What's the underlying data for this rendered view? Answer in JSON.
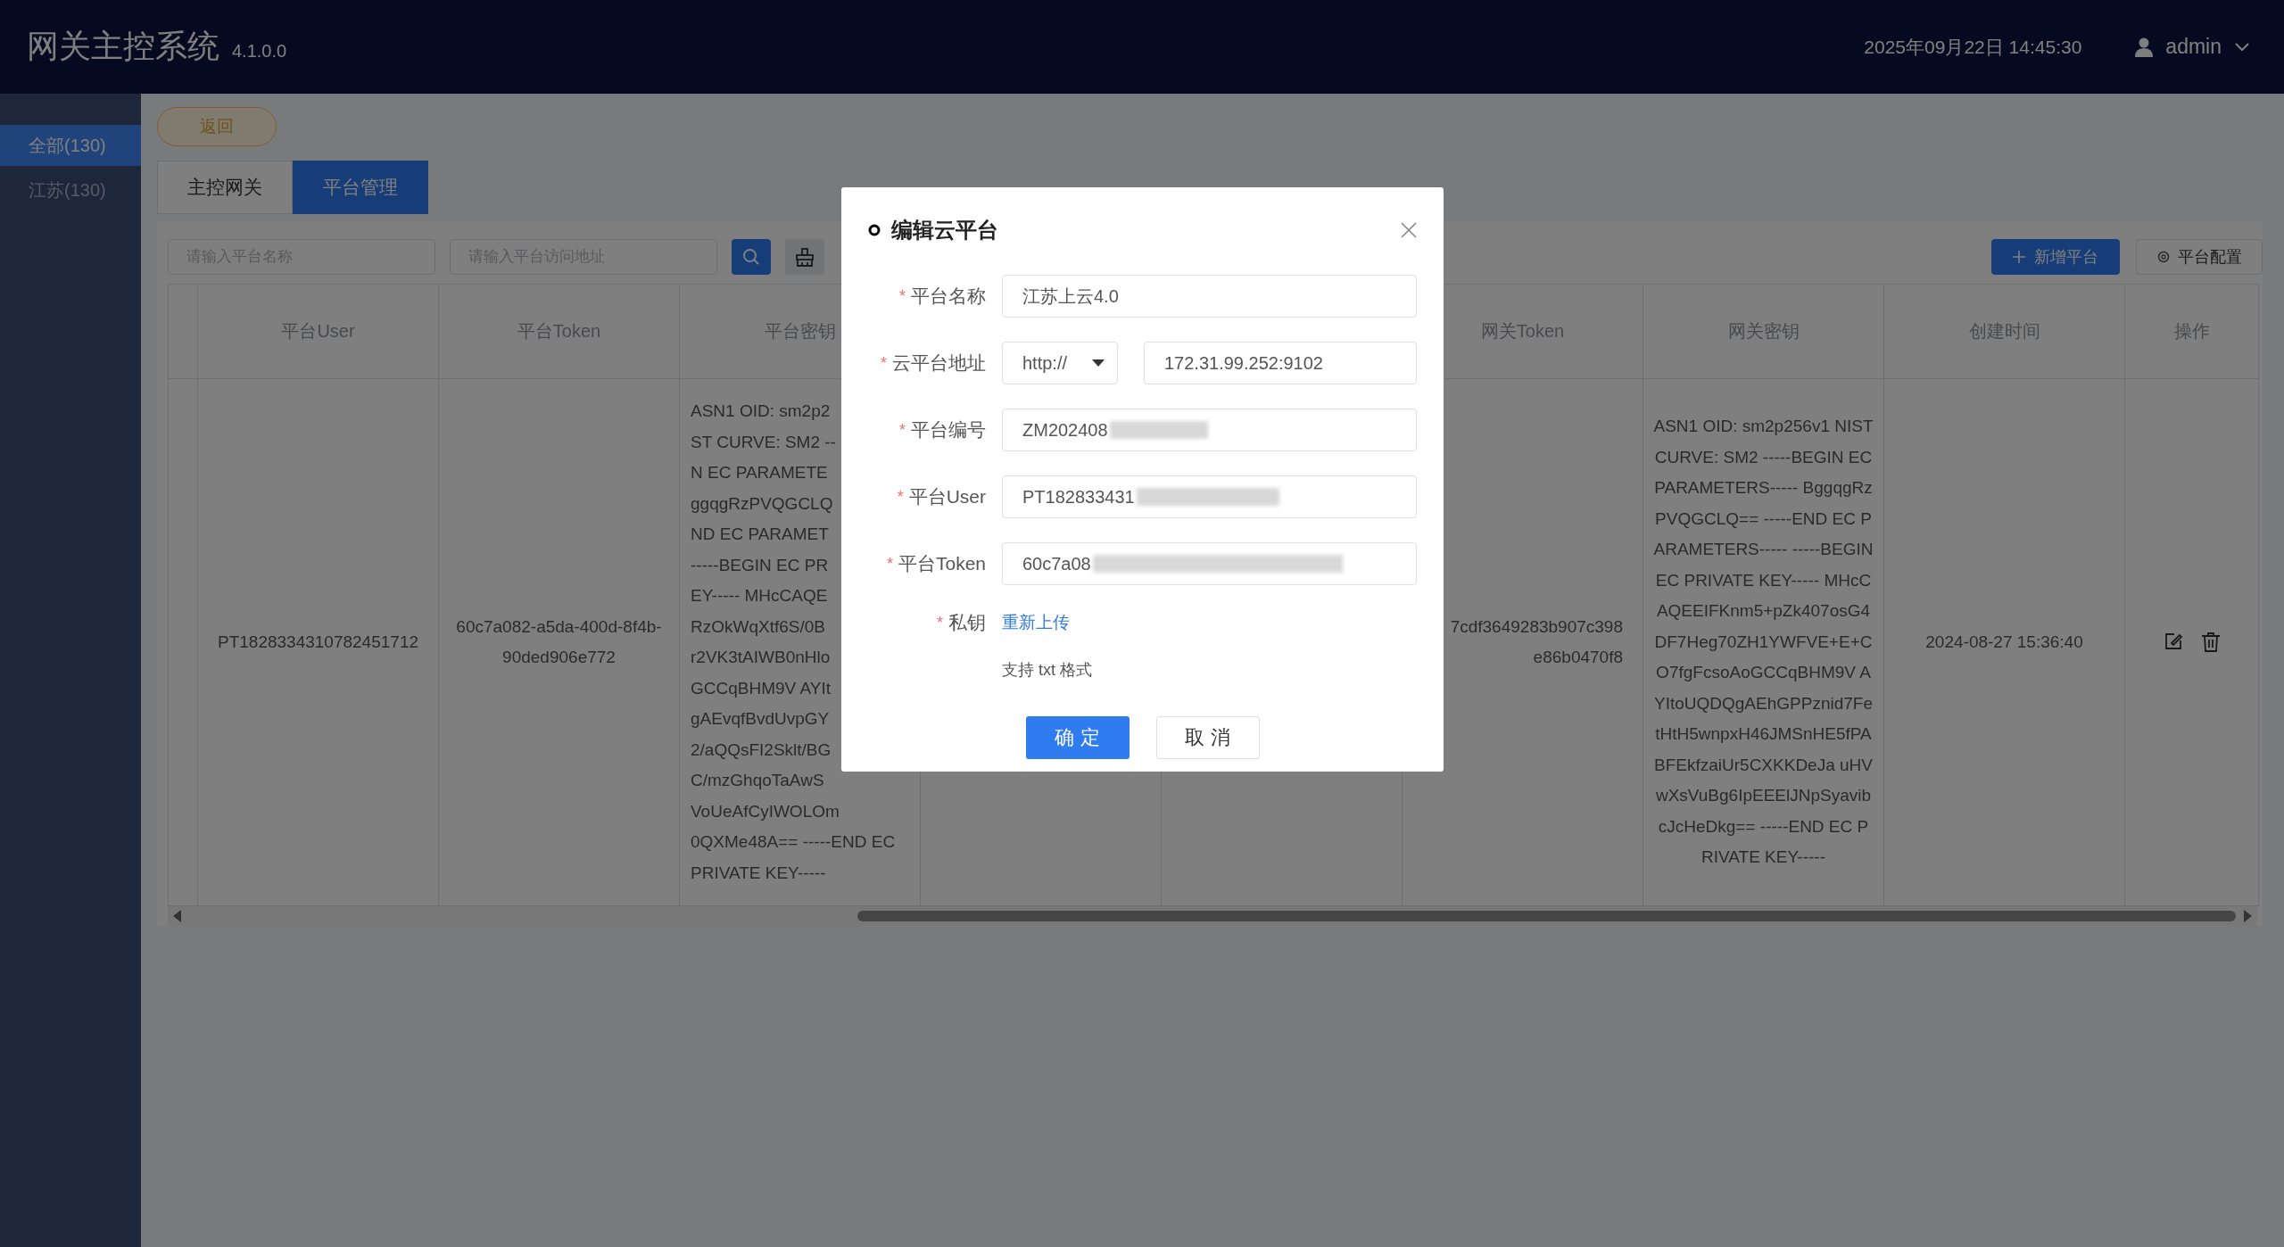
{
  "header": {
    "title": "网关主控系统",
    "version": "4.1.0.0",
    "datetime": "2025年09月22日 14:45:30",
    "user": "admin"
  },
  "sidebar": {
    "items": [
      {
        "label": "全部(130)",
        "selected": true
      },
      {
        "label": "江苏(130)",
        "selected": false
      }
    ]
  },
  "back_button": "返回",
  "tabs": [
    {
      "label": "主控网关",
      "selected": false
    },
    {
      "label": "平台管理",
      "selected": true
    }
  ],
  "toolbar": {
    "search_fields": [
      {
        "placeholder": "请输入平台名称"
      },
      {
        "placeholder": "请输入平台访问地址"
      }
    ],
    "add_button": "新增平台",
    "config_button": "平台配置"
  },
  "table": {
    "columns": [
      {
        "kind": "blank"
      },
      {
        "kind": "label",
        "label": "平台User"
      },
      {
        "kind": "label",
        "label": "平台Token"
      },
      {
        "kind": "label",
        "label": "平台密钥"
      },
      {
        "kind": "blank"
      },
      {
        "kind": "blank"
      },
      {
        "kind": "label",
        "label": "网关Token"
      },
      {
        "kind": "label",
        "label": "网关密钥"
      },
      {
        "kind": "label",
        "label": "创建时间"
      },
      {
        "kind": "label",
        "label": "操作"
      }
    ],
    "rows": [
      {
        "cells": [
          {
            "kind": "blank"
          },
          {
            "kind": "text",
            "text": "PT1828334310782451712"
          },
          {
            "kind": "text",
            "text": "60c7a082-a5da-400d-8f4b-90ded906e772"
          },
          {
            "kind": "cut_right",
            "lines": [
              "ASN1 OID: sm2p2",
              "ST CURVE: SM2 --",
              "N EC PARAMETE",
              "ggqgRzPVQGCLQ",
              "ND EC PARAMET",
              "-----BEGIN EC PR",
              "EY----- MHcCAQE",
              "RzOkWqXtf6S/0B",
              "r2VK3tAIWB0nHlo",
              "GCCqBHM9V AYIt",
              "gAEvqfBvdUvpGY",
              "2/aQQsFI2Sklt/BG",
              "C/mzGhqoTaAwS",
              "VoUeAfCyIWOLOm",
              "0QXMe48A== -----END EC",
              "PRIVATE KEY-----"
            ]
          },
          {
            "kind": "blank"
          },
          {
            "kind": "blank"
          },
          {
            "kind": "cut_left",
            "lines": [
              "7cdf3649283b907c398",
              "e86b0470f8"
            ]
          },
          {
            "kind": "text",
            "text": "ASN1 OID: sm2p256v1 NIST CURVE: SM2 -----BEGIN EC PARAMETERS----- BggqgRzPVQGCLQ== -----END EC PARAMETERS----- -----BEGIN EC PRIVATE KEY----- MHcCAQEEIFKnm5+pZk407osG4DF7Heg70ZH1YWFVE+E+CO7fgFcsoAoGCCqBHM9V AYItoUQDQgAEhGPPznid7FetHtH5wnpxH46JMSnHE5fPABFEkfzaiUr5CXKKDeJa uHVwXsVuBg6IpEEElJNpSyavibcJcHeDkg== -----END EC PRIVATE KEY-----"
          },
          {
            "kind": "text",
            "text": "2024-08-27 15:36:40"
          },
          {
            "kind": "actions"
          }
        ]
      }
    ]
  },
  "dialog": {
    "title": "编辑云平台",
    "fields": [
      {
        "kind": "input",
        "required_mark": "*",
        "label": "平台名称",
        "value": "江苏上云4.0",
        "redacted": false
      },
      {
        "kind": "address",
        "required_mark": "*",
        "label": "云平台地址",
        "scheme": "http://",
        "value": "172.31.99.252:9102",
        "redacted": false
      },
      {
        "kind": "input",
        "required_mark": "*",
        "label": "平台编号",
        "value": "ZM202408",
        "redacted": true
      },
      {
        "kind": "input",
        "required_mark": "*",
        "label": "平台User",
        "value": "PT182833431",
        "redacted": true
      },
      {
        "kind": "input",
        "required_mark": "*",
        "label": "平台Token",
        "value": "60c7a08",
        "redacted": true
      },
      {
        "kind": "upload",
        "required_mark": "*",
        "label": "私钥",
        "link": "重新上传",
        "hint": "支持 txt 格式"
      }
    ],
    "buttons": [
      {
        "kind": "primary",
        "label": "确 定"
      },
      {
        "kind": "default",
        "label": "取 消"
      }
    ]
  }
}
